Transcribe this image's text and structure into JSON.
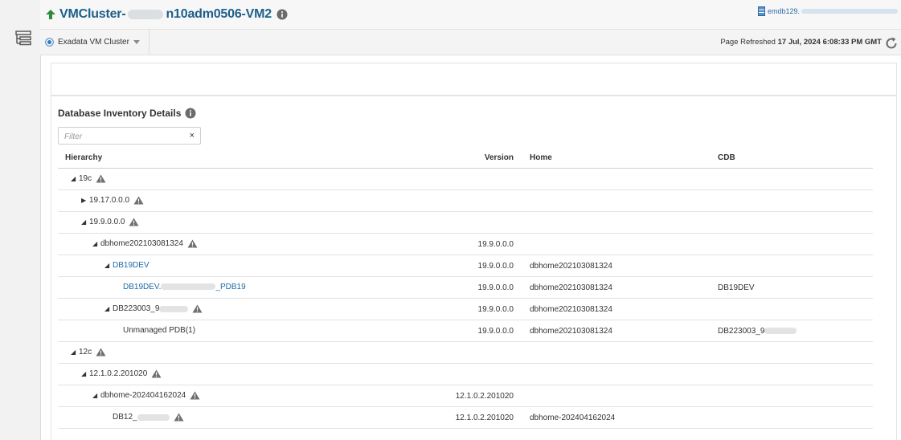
{
  "header": {
    "title_prefix": "VMCluster-",
    "title_suffix": "n10adm0506-VM2",
    "host_prefix": "emdb129."
  },
  "toolbar": {
    "target_menu": "Exadata VM Cluster",
    "refresh_label": "Page Refreshed",
    "refresh_time": "17 Jul, 2024 6:08:33 PM GMT"
  },
  "section": {
    "title": "Database Inventory Details",
    "filter_placeholder": "Filter",
    "filter_clear": "×"
  },
  "table": {
    "columns": [
      "Hierarchy",
      "Version",
      "Home",
      "CDB"
    ],
    "rows": [
      {
        "label": "19c",
        "version": "",
        "home": "",
        "cdb": ""
      },
      {
        "label": "19.17.0.0.0",
        "version": "",
        "home": "",
        "cdb": ""
      },
      {
        "label": "19.9.0.0.0",
        "version": "",
        "home": "",
        "cdb": ""
      },
      {
        "label": "dbhome202103081324",
        "version": "19.9.0.0.0",
        "home": "",
        "cdb": ""
      },
      {
        "label": "DB19DEV",
        "version": "19.9.0.0.0",
        "home": "dbhome202103081324",
        "cdb": ""
      },
      {
        "label_prefix": "DB19DEV.",
        "label_suffix": "_PDB19",
        "version": "19.9.0.0.0",
        "home": "dbhome202103081324",
        "cdb": "DB19DEV"
      },
      {
        "label": "DB223003_9",
        "version": "19.9.0.0.0",
        "home": "dbhome202103081324",
        "cdb": ""
      },
      {
        "label": "Unmanaged PDB(1)",
        "version": "19.9.0.0.0",
        "home": "dbhome202103081324",
        "cdb": "DB223003_9"
      },
      {
        "label": "12c",
        "version": "",
        "home": "",
        "cdb": ""
      },
      {
        "label": "12.1.0.2.201020",
        "version": "",
        "home": "",
        "cdb": ""
      },
      {
        "label": "dbhome-202404162024",
        "version": "12.1.0.2.201020",
        "home": "",
        "cdb": ""
      },
      {
        "label": "DB12_",
        "version": "12.1.0.2.201020",
        "home": "dbhome-202404162024",
        "cdb": ""
      }
    ]
  },
  "colors": {
    "accent": "#1d5f8a",
    "link": "#1d6aa5",
    "status_up": "#2e8b3a",
    "warning": "#6f6f6f"
  },
  "icons": [
    "menu-icon",
    "up-arrow-icon",
    "info-icon",
    "database-icon",
    "radio-icon",
    "caret-down-icon",
    "refresh-icon",
    "triangle-expanded-icon",
    "triangle-collapsed-icon",
    "warning-icon",
    "clear-icon"
  ]
}
